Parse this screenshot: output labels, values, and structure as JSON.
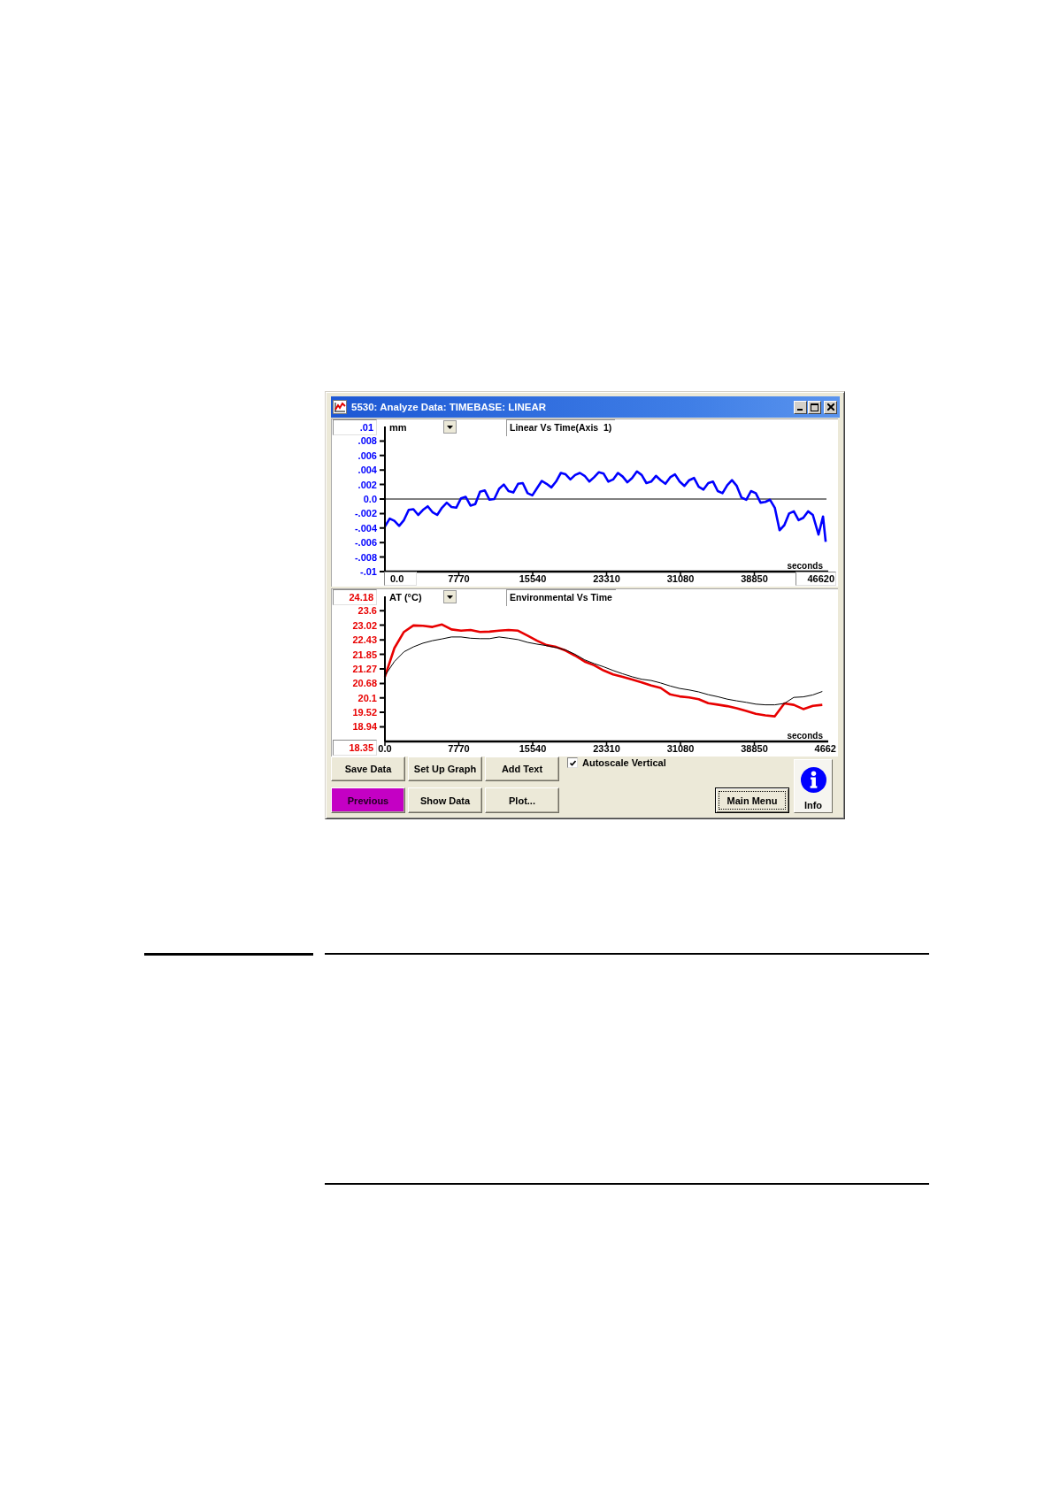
{
  "window": {
    "title": "5530: Analyze Data: TIMEBASE: LINEAR"
  },
  "panels": [
    {
      "y_max_field": {
        "value": ".01"
      },
      "unit_dropdown": {
        "value": "mm"
      },
      "x_min_field": {
        "value": "0.0"
      },
      "x_max_field": {
        "value": "46620"
      },
      "chart_data": {
        "type": "line",
        "title": "Linear Vs Time(Axis  1)",
        "xlabel": "seconds",
        "x": [
          0,
          500,
          1000,
          1500,
          2000,
          2500,
          3000,
          3500,
          4000,
          4500,
          5000,
          5500,
          6000,
          6500,
          7000,
          7500,
          8000,
          8500,
          9000,
          9500,
          10000,
          10500,
          11000,
          11500,
          12000,
          12500,
          13000,
          13500,
          14000,
          14500,
          15000,
          15500,
          16000,
          16500,
          17000,
          17500,
          18000,
          18500,
          19000,
          19500,
          20000,
          20500,
          21000,
          21500,
          22000,
          22500,
          23000,
          23500,
          24000,
          24500,
          25000,
          25500,
          26000,
          26500,
          27000,
          27500,
          28000,
          28500,
          29000,
          29500,
          30000,
          30500,
          31000,
          31500,
          32000,
          32500,
          33000,
          33500,
          34000,
          34500,
          35000,
          35500,
          36000,
          36500,
          37000,
          37500,
          38000,
          38500,
          39000,
          39500,
          40000,
          40500,
          41000,
          41500,
          42000,
          42500,
          43000,
          43500,
          44000,
          44500,
          45000,
          45600,
          46070,
          46350
        ],
        "series": [
          {
            "color": "#0000ff",
            "values": [
              -0.0038,
              -0.0027,
              -0.003,
              -0.0037,
              -0.0029,
              -0.0015,
              -0.0014,
              -0.0022,
              -0.0015,
              -0.001,
              -0.0018,
              -0.0022,
              -0.0012,
              -0.0005,
              -0.0011,
              -0.0012,
              0.0001,
              0.0003,
              -0.0009,
              -0.0007,
              0.001,
              0.0012,
              -0.0001,
              0.0,
              0.0014,
              0.002,
              0.0011,
              0.0009,
              0.0021,
              0.0022,
              0.0008,
              0.0005,
              0.0015,
              0.0025,
              0.0021,
              0.0016,
              0.0024,
              0.0036,
              0.0034,
              0.0027,
              0.0033,
              0.0036,
              0.0032,
              0.0024,
              0.003,
              0.0037,
              0.0035,
              0.0024,
              0.0027,
              0.0036,
              0.0031,
              0.0023,
              0.0029,
              0.0038,
              0.0033,
              0.0022,
              0.0024,
              0.0032,
              0.0026,
              0.0021,
              0.003,
              0.0034,
              0.0024,
              0.0018,
              0.0026,
              0.0029,
              0.0017,
              0.0013,
              0.0022,
              0.0024,
              0.0011,
              0.0008,
              0.0019,
              0.0026,
              0.0018,
              0.0002,
              -0.0001,
              0.0011,
              0.0008,
              -0.0005,
              -0.0004,
              -0.0001,
              -0.0012,
              -0.0043,
              -0.0036,
              -0.002,
              -0.0017,
              -0.0029,
              -0.0026,
              -0.0017,
              -0.0022,
              -0.0049,
              -0.0024,
              -0.0059
            ]
          }
        ],
        "xlim": [
          0,
          46620
        ],
        "ylim": [
          -0.01,
          0.01
        ],
        "xticks": [
          7770,
          15540,
          23310,
          31080,
          38850
        ],
        "yticks": [
          {
            "value": 0.008,
            "label": ".008"
          },
          {
            "value": 0.006,
            "label": ".006"
          },
          {
            "value": 0.004,
            "label": ".004"
          },
          {
            "value": 0.002,
            "label": ".002"
          },
          {
            "value": 0,
            "label": "0.0"
          },
          {
            "value": -0.002,
            "label": "-.002"
          },
          {
            "value": -0.004,
            "label": "-.004"
          },
          {
            "value": -0.006,
            "label": "-.006"
          },
          {
            "value": -0.008,
            "label": "-.008"
          },
          {
            "value": -0.01,
            "label": "-.01"
          }
        ]
      }
    },
    {
      "y_max_field": {
        "value": "24.18"
      },
      "unit_dropdown": {
        "value": "AT (°C)"
      },
      "y_min_field": {
        "value": "18.35"
      },
      "x_max_label": {
        "value": "4662"
      },
      "chart_data": {
        "type": "line",
        "title": "Environmental Vs Time",
        "xlabel": "seconds",
        "x": [
          0,
          1000,
          2000,
          3000,
          4000,
          5000,
          6000,
          7000,
          8000,
          9000,
          10000,
          11000,
          12000,
          13000,
          14000,
          15000,
          16000,
          17000,
          18000,
          19000,
          20000,
          21000,
          22000,
          23000,
          24000,
          25000,
          26000,
          27000,
          28000,
          29000,
          30000,
          31000,
          32000,
          33000,
          34000,
          35000,
          36000,
          37000,
          38000,
          39000,
          40000,
          41000,
          42000,
          43000,
          44000,
          45000,
          46000
        ],
        "series": [
          {
            "color": "#e80000",
            "values": [
              20.95,
              22.1,
              22.75,
              23.01,
              23.0,
              22.95,
              23.05,
              22.85,
              22.8,
              22.83,
              22.75,
              22.76,
              22.8,
              22.83,
              22.8,
              22.6,
              22.4,
              22.22,
              22.15,
              22.0,
              21.8,
              21.56,
              21.41,
              21.2,
              21.04,
              20.95,
              20.84,
              20.72,
              20.6,
              20.5,
              20.24,
              20.16,
              20.12,
              20.05,
              19.89,
              19.83,
              19.77,
              19.68,
              19.58,
              19.46,
              19.4,
              19.36,
              19.88,
              19.82,
              19.65,
              19.78,
              19.82
            ]
          },
          {
            "color": "#000000",
            "values": [
              21.0,
              21.56,
              21.95,
              22.15,
              22.3,
              22.4,
              22.47,
              22.55,
              22.55,
              22.5,
              22.48,
              22.48,
              22.55,
              22.5,
              22.44,
              22.33,
              22.26,
              22.2,
              22.12,
              22.03,
              21.85,
              21.63,
              21.48,
              21.35,
              21.2,
              21.07,
              20.95,
              20.85,
              20.8,
              20.7,
              20.58,
              20.48,
              20.42,
              20.34,
              20.23,
              20.15,
              20.05,
              19.98,
              19.92,
              19.85,
              19.82,
              19.82,
              19.88,
              20.12,
              20.14,
              20.22,
              20.36
            ]
          }
        ],
        "xlim": [
          0,
          46620
        ],
        "ylim": [
          18.35,
          24.18
        ],
        "xticks": [
          {
            "value": 0,
            "label": "0.0"
          },
          7770,
          15540,
          23310,
          31080,
          38850
        ],
        "yticks": [
          23.6,
          23.02,
          22.43,
          21.85,
          21.27,
          20.68,
          20.1,
          19.52,
          18.94
        ]
      }
    }
  ],
  "buttons": [
    {
      "label": "Save Data",
      "highlighted": false
    },
    {
      "label": "Set Up Graph",
      "highlighted": false
    },
    {
      "label": "Add Text",
      "highlighted": false
    },
    {
      "label": "Previous",
      "highlighted": true
    },
    {
      "label": "Show Data",
      "highlighted": false
    },
    {
      "label": "Plot...",
      "highlighted": false
    }
  ],
  "autoscale_vertical": {
    "label": "Autoscale Vertical",
    "checked": true
  },
  "main_menu_button": {
    "label": "Main Menu",
    "focused": true
  },
  "info_button": {
    "label": "Info"
  }
}
